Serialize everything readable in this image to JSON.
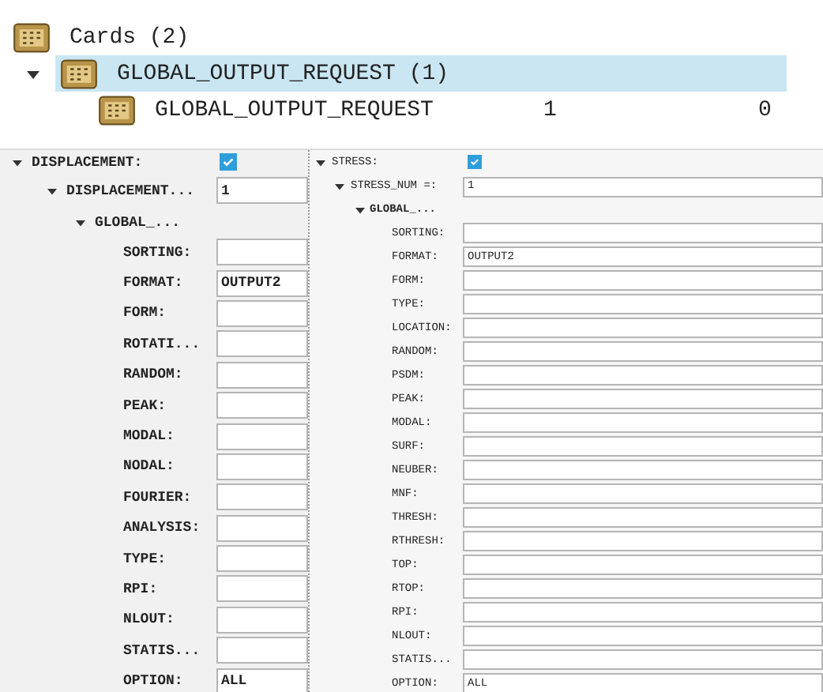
{
  "tree": {
    "label": "Cards (2)",
    "selected": false,
    "children": [
      {
        "label": "GLOBAL_OUTPUT_REQUEST (1)",
        "selected": true,
        "expanded": true,
        "children": [
          {
            "label": "GLOBAL_OUTPUT_REQUEST",
            "selected": false,
            "column_2": "1",
            "column_3": "0"
          }
        ]
      }
    ]
  },
  "panels": [
    {
      "label": "DISPLACEMENT:",
      "checked": true,
      "expanded": true,
      "sub": {
        "label": "DISPLACEMENT...",
        "value": "1",
        "expanded": true,
        "group": {
          "label": "GLOBAL_...",
          "expanded": true,
          "fields": [
            {
              "label": "SORTING:"
            },
            {
              "label": "FORMAT:",
              "value": "OUTPUT2"
            },
            {
              "label": "FORM:"
            },
            {
              "label": "ROTATI..."
            },
            {
              "label": "RANDOM:"
            },
            {
              "label": "PEAK:"
            },
            {
              "label": "MODAL:"
            },
            {
              "label": "NODAL:"
            },
            {
              "label": "FOURIER:"
            },
            {
              "label": "ANALYSIS:"
            },
            {
              "label": "TYPE:"
            },
            {
              "label": "RPI:"
            },
            {
              "label": "NLOUT:"
            },
            {
              "label": "STATIS..."
            },
            {
              "label": "OPTION:",
              "value": "ALL"
            }
          ]
        }
      }
    },
    {
      "label": "STRESS:",
      "checked": true,
      "expanded": true,
      "sub": {
        "label": "STRESS_NUM =:",
        "value": "1",
        "expanded": true,
        "group": {
          "label": "GLOBAL_...",
          "expanded": true,
          "fields": [
            {
              "label": "SORTING:"
            },
            {
              "label": "FORMAT:",
              "value": "OUTPUT2"
            },
            {
              "label": "FORM:"
            },
            {
              "label": "TYPE:"
            },
            {
              "label": "LOCATION:"
            },
            {
              "label": "RANDOM:"
            },
            {
              "label": "PSDM:"
            },
            {
              "label": "PEAK:"
            },
            {
              "label": "MODAL:"
            },
            {
              "label": "SURF:"
            },
            {
              "label": "NEUBER:"
            },
            {
              "label": "MNF:"
            },
            {
              "label": "THRESH:"
            },
            {
              "label": "RTHRESH:"
            },
            {
              "label": "TOP:"
            },
            {
              "label": "RTOP:"
            },
            {
              "label": "RPI:"
            },
            {
              "label": "NLOUT:"
            },
            {
              "label": "STATIS..."
            },
            {
              "label": "OPTION:",
              "value": "ALL"
            }
          ]
        }
      }
    }
  ]
}
